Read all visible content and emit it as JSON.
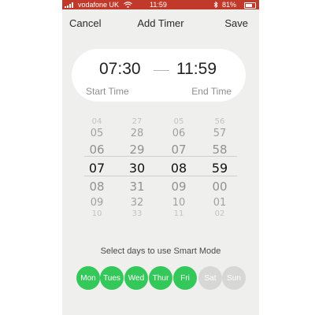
{
  "status_bar": {
    "carrier": "vodafone UK",
    "time": "11:59",
    "battery": "81%",
    "battery_level": 0.81,
    "color": "#c0392b",
    "icons": [
      "signal-icon",
      "wifi-icon",
      "bluetooth-icon",
      "battery-icon"
    ]
  },
  "nav": {
    "cancel": "Cancel",
    "title": "Add Timer",
    "save": "Save"
  },
  "time_card": {
    "start_time": "07:30",
    "end_time": "11:59",
    "start_label": "Start Time",
    "end_label": "End Time"
  },
  "picker": {
    "columns": [
      {
        "name": "start-hour",
        "values": [
          "04",
          "05",
          "06",
          "07",
          "08",
          "09",
          "10"
        ]
      },
      {
        "name": "start-minute",
        "values": [
          "27",
          "28",
          "29",
          "30",
          "31",
          "32",
          "33"
        ]
      },
      {
        "name": "end-hour",
        "values": [
          "05",
          "06",
          "07",
          "08",
          "09",
          "10",
          "11"
        ]
      },
      {
        "name": "end-minute",
        "values": [
          "56",
          "57",
          "58",
          "59",
          "00",
          "01",
          "02"
        ]
      }
    ],
    "selected_index": 3
  },
  "days": {
    "label": "Select days to use Smart Mode",
    "active_color": "#34c759",
    "inactive_color": "#d7d7d5",
    "items": [
      {
        "label": "Mon",
        "selected": true
      },
      {
        "label": "Tues",
        "selected": true
      },
      {
        "label": "Wed",
        "selected": true
      },
      {
        "label": "Thur",
        "selected": true
      },
      {
        "label": "Fri",
        "selected": true
      },
      {
        "label": "Sat",
        "selected": false
      },
      {
        "label": "Sun",
        "selected": false
      }
    ]
  }
}
